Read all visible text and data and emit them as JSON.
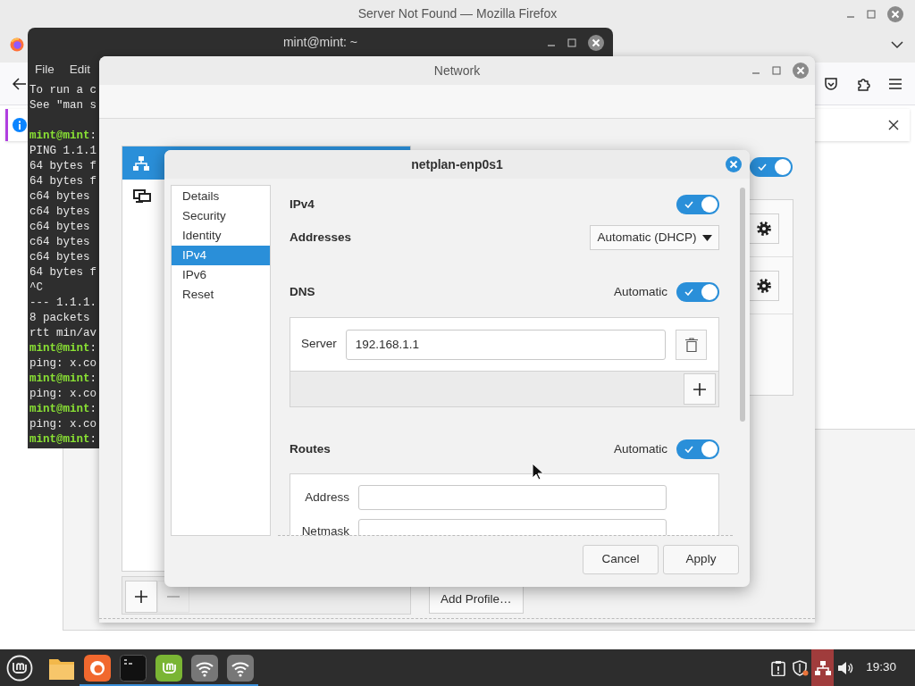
{
  "firefox": {
    "title": "Server Not Found — Mozilla Firefox"
  },
  "terminal": {
    "title": "mint@mint: ~",
    "menu": [
      "File",
      "Edit"
    ],
    "lines": [
      {
        "kind": "output",
        "text": "To run a c"
      },
      {
        "kind": "output",
        "text": "See \"man s"
      },
      {
        "kind": "blank"
      },
      {
        "kind": "prompt",
        "user": "mint@mint",
        "text": ":"
      },
      {
        "kind": "output",
        "text": "PING 1.1.1"
      },
      {
        "kind": "output",
        "text": "64 bytes f"
      },
      {
        "kind": "output",
        "text": "64 bytes f"
      },
      {
        "kind": "output",
        "text": "c64 bytes"
      },
      {
        "kind": "output",
        "text": "c64 bytes"
      },
      {
        "kind": "output",
        "text": "c64 bytes"
      },
      {
        "kind": "output",
        "text": "c64 bytes"
      },
      {
        "kind": "output",
        "text": "c64 bytes"
      },
      {
        "kind": "output",
        "text": "64 bytes f"
      },
      {
        "kind": "output",
        "text": "^C"
      },
      {
        "kind": "output",
        "text": "--- 1.1.1."
      },
      {
        "kind": "output",
        "text": "8 packets"
      },
      {
        "kind": "output",
        "text": "rtt min/av"
      },
      {
        "kind": "prompt",
        "user": "mint@mint",
        "text": ":"
      },
      {
        "kind": "output",
        "text": "ping: x.co"
      },
      {
        "kind": "prompt",
        "user": "mint@mint",
        "text": ":"
      },
      {
        "kind": "output",
        "text": "ping: x.co"
      },
      {
        "kind": "prompt",
        "user": "mint@mint",
        "text": ":"
      },
      {
        "kind": "output",
        "text": "ping: x.co"
      },
      {
        "kind": "prompt",
        "user": "mint@mint",
        "text": ":"
      }
    ]
  },
  "network": {
    "title": "Network",
    "devices": [
      {
        "kind": "wired",
        "selected": true
      },
      {
        "kind": "network",
        "selected": false
      }
    ],
    "enabled": true,
    "add_profile": "Add Profile…"
  },
  "dialog": {
    "title": "netplan-enp0s1",
    "sections": [
      {
        "label": "Details",
        "selected": false
      },
      {
        "label": "Security",
        "selected": false
      },
      {
        "label": "Identity",
        "selected": false
      },
      {
        "label": "IPv4",
        "selected": true
      },
      {
        "label": "IPv6",
        "selected": false
      },
      {
        "label": "Reset",
        "selected": false
      }
    ],
    "ipv4": {
      "label": "IPv4",
      "on": true
    },
    "addresses": {
      "label": "Addresses",
      "value": "Automatic (DHCP)"
    },
    "dns": {
      "label": "DNS",
      "auto_label": "Automatic",
      "on": true,
      "server_label": "Server",
      "server": "192.168.1.1"
    },
    "routes": {
      "label": "Routes",
      "auto_label": "Automatic",
      "on": true,
      "fields": [
        "Address",
        "Netmask"
      ]
    },
    "buttons": [
      "Cancel",
      "Apply"
    ]
  },
  "taskbar": {
    "apps": [
      {
        "kind": "files",
        "running": false
      },
      {
        "kind": "browser",
        "running": true
      },
      {
        "kind": "terminal",
        "running": true
      },
      {
        "kind": "software",
        "running": true
      },
      {
        "kind": "wifi",
        "running": true
      },
      {
        "kind": "wifi",
        "running": true
      }
    ],
    "tray": [
      {
        "kind": "notes",
        "highlighted": false
      },
      {
        "kind": "shield",
        "highlighted": false
      },
      {
        "kind": "network",
        "highlighted": true
      },
      {
        "kind": "volume",
        "highlighted": false
      }
    ],
    "clock": "19:30"
  }
}
